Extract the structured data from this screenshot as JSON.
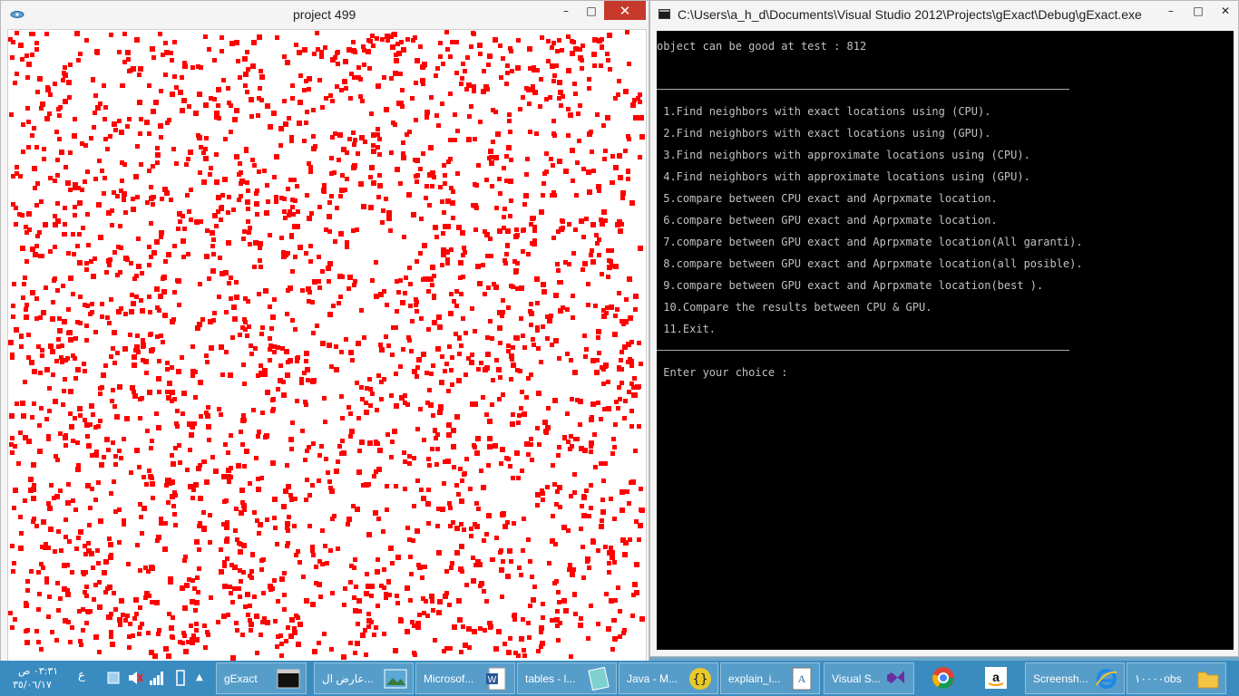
{
  "project_window": {
    "title": "project 499",
    "controls": {
      "minimize": "–",
      "maximize": "□",
      "close": "✕"
    },
    "point_color": "#ff0000"
  },
  "console_window": {
    "title": "C:\\Users\\a_h_d\\Documents\\Visual Studio 2012\\Projects\\gExact\\Debug\\gExact.exe",
    "controls": {
      "minimize": "–",
      "maximize": "□",
      "close": "✕"
    },
    "header_line": "object can be good at test : 812",
    "menu": [
      " 1.Find neighbors with exact locations using (CPU).",
      " 2.Find neighbors with exact locations using (GPU).",
      " 3.Find neighbors with approximate locations using (CPU).",
      " 4.Find neighbors with approximate locations using (GPU).",
      " 5.compare between CPU exact and Aprpxmate location.",
      " 6.compare between GPU exact and Aprpxmate location.",
      " 7.compare between GPU exact and Aprpxmate location(All garanti).",
      " 8.compare between GPU exact and Aprpxmate location(all posible).",
      " 9.compare between GPU exact and Aprpxmate location(best ).",
      " 10.Compare the results between CPU & GPU.",
      " 11.Exit."
    ],
    "prompt": " Enter your choice :"
  },
  "taskbar": {
    "clock_time": "٠٣:٣١ ص",
    "clock_date": "٣٥/٠٦/١٧",
    "lang": "ع",
    "tasks": [
      {
        "label": "gExact",
        "icon": "console-icon"
      },
      {
        "label": "عارض ال...",
        "icon": "photo-viewer-icon"
      },
      {
        "label": "Microsof...",
        "icon": "word-icon"
      },
      {
        "label": "tables - l...",
        "icon": "notebook-icon"
      },
      {
        "label": "Java - M...",
        "icon": "braces-icon"
      },
      {
        "label": "explain_i...",
        "icon": "wordpad-icon"
      },
      {
        "label": "Visual S...",
        "icon": "visual-studio-icon"
      },
      {
        "label": "",
        "icon": "chrome-icon"
      },
      {
        "label": "",
        "icon": "amazon-icon"
      },
      {
        "label": "Screensh...",
        "icon": "ie-icon"
      },
      {
        "label": "١٠٠٠٠obs",
        "icon": "folder-icon"
      }
    ]
  }
}
